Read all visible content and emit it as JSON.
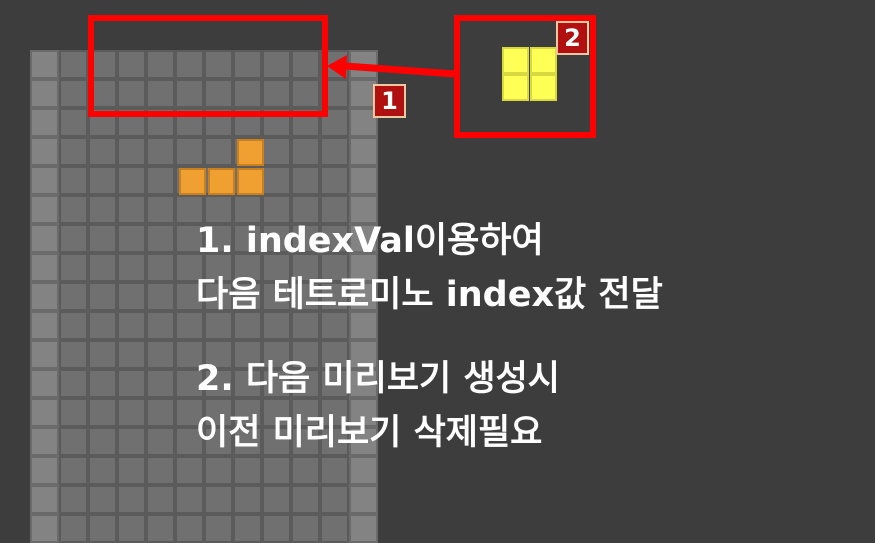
{
  "annotations": {
    "badge_1": "1",
    "badge_2": "2",
    "note_1_line_1": "1. indexVal이용하여",
    "note_1_line_2": "다음 테트로미노 index값 전달",
    "note_2_line_1": "2. 다음 미리보기 생성시",
    "note_2_line_2": "이전 미리보기 삭제필요"
  },
  "game": {
    "board_columns": 12,
    "board_rows": 17,
    "current_piece": {
      "shape": "L",
      "color": "#f0a030"
    },
    "next_piece": {
      "shape": "O",
      "color": "#ffff55"
    }
  },
  "colors": {
    "highlight": "#ff0000",
    "badge_fill": "#b01010",
    "background": "#3d3d3d"
  }
}
